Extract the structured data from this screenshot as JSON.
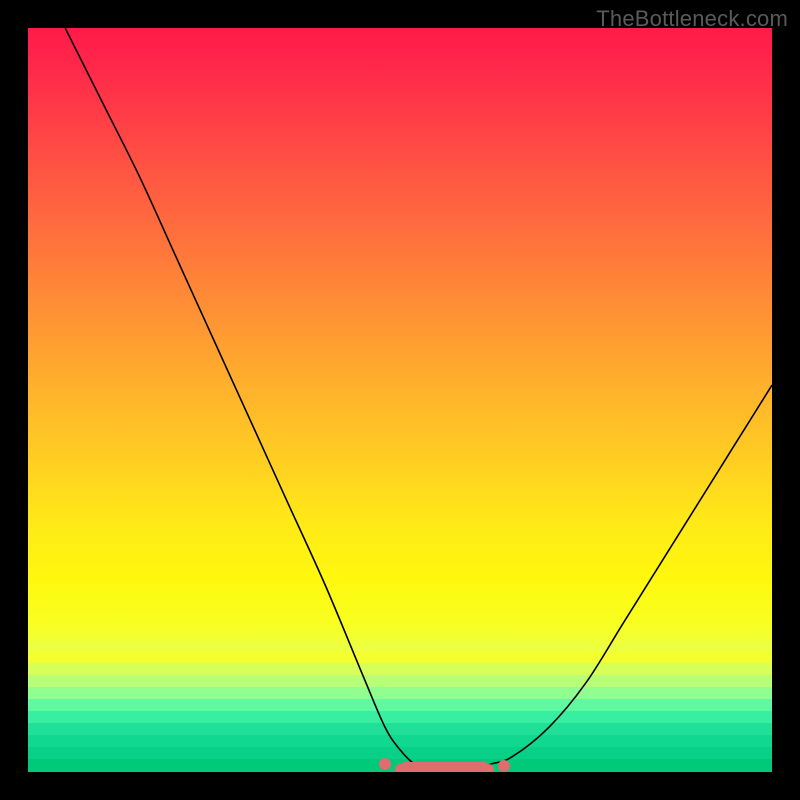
{
  "watermark": {
    "text": "TheBottleneck.com"
  },
  "colors": {
    "band_stripes": [
      "#f4ff30",
      "#d8ff58",
      "#b8ff78",
      "#90ff90",
      "#60f8a0",
      "#38eea0",
      "#20e098",
      "#10d890",
      "#08d088",
      "#00c97a"
    ],
    "pink": "#e06d6d",
    "curve": "#000000"
  },
  "chart_data": {
    "type": "line",
    "title": "",
    "xlabel": "",
    "ylabel": "",
    "xlim": [
      0,
      100
    ],
    "ylim": [
      0,
      100
    ],
    "grid": false,
    "legend": null,
    "annotations": [
      "TheBottleneck.com"
    ],
    "series": [
      {
        "name": "curve",
        "x": [
          5,
          10,
          15,
          20,
          25,
          30,
          35,
          40,
          45,
          48,
          50,
          52,
          54,
          56,
          58,
          60,
          62,
          65,
          70,
          75,
          80,
          85,
          90,
          95,
          100
        ],
        "y": [
          100,
          90,
          80,
          69,
          58,
          47,
          36,
          25,
          13,
          6,
          3,
          1,
          0,
          0,
          0,
          0,
          1,
          2,
          6,
          12,
          20,
          28,
          36,
          44,
          52
        ]
      }
    ],
    "flat_region": {
      "x_start": 50,
      "x_end": 62,
      "y": 0
    },
    "flat_region_markers_x": [
      48,
      50,
      52,
      54,
      56,
      58,
      60,
      62,
      64
    ],
    "background_gradient": {
      "orientation": "vertical",
      "stops": [
        {
          "pos": 0.0,
          "color": "#ff1a4a"
        },
        {
          "pos": 0.3,
          "color": "#ff7a38"
        },
        {
          "pos": 0.6,
          "color": "#ffd61e"
        },
        {
          "pos": 0.8,
          "color": "#f6ff20"
        },
        {
          "pos": 0.92,
          "color": "#90ff90"
        },
        {
          "pos": 1.0,
          "color": "#00c97a"
        }
      ]
    }
  }
}
